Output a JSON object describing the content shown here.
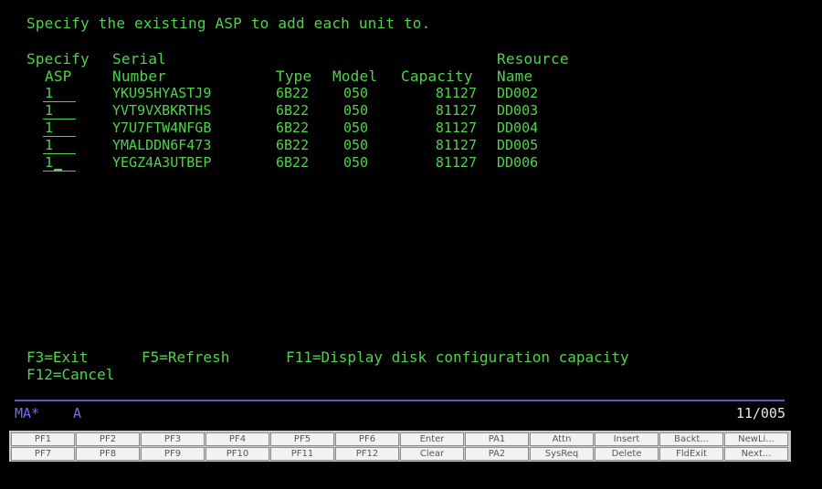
{
  "screen": {
    "instruction": "Specify the existing ASP to add each unit to.",
    "headers": {
      "specify_1": "Specify",
      "specify_2": "ASP",
      "serial_1": "Serial",
      "serial_2": "Number",
      "type": "Type",
      "model": "Model",
      "capacity": "Capacity",
      "resource_1": "Resource",
      "resource_2": "Name"
    },
    "rows": [
      {
        "asp": "1",
        "serial": "YKU95HYASTJ9",
        "type": "6B22",
        "model": "050",
        "capacity": "81127",
        "resource": "DD002"
      },
      {
        "asp": "1",
        "serial": "YVT9VXBKRTHS",
        "type": "6B22",
        "model": "050",
        "capacity": "81127",
        "resource": "DD003"
      },
      {
        "asp": "1",
        "serial": "Y7U7FTW4NFGB",
        "type": "6B22",
        "model": "050",
        "capacity": "81127",
        "resource": "DD004"
      },
      {
        "asp": "1",
        "serial": "YMALDDN6F473",
        "type": "6B22",
        "model": "050",
        "capacity": "81127",
        "resource": "DD005"
      },
      {
        "asp": "1",
        "serial": "YEGZ4A3UTBEP",
        "type": "6B22",
        "model": "050",
        "capacity": "81127",
        "resource": "DD006"
      }
    ],
    "function_keys": {
      "f3": "F3=Exit",
      "f5": "F5=Refresh",
      "f11": "F11=Display disk configuration capacity",
      "f12": "F12=Cancel"
    }
  },
  "status_bar": {
    "session": "MA*",
    "mode": "A",
    "cursor_position": "11/005"
  },
  "keypad": {
    "row1": [
      "PF1",
      "PF2",
      "PF3",
      "PF4",
      "PF5",
      "PF6",
      "Enter",
      "PA1",
      "Attn",
      "Insert",
      "Backt...",
      "NewLi..."
    ],
    "row2": [
      "PF7",
      "PF8",
      "PF9",
      "PF10",
      "PF11",
      "PF12",
      "Clear",
      "PA2",
      "SysReq",
      "Delete",
      "FldExit",
      "Next..."
    ]
  },
  "colors": {
    "screen_text": "#4fd34a",
    "background": "#000000",
    "divider": "#5e57c8"
  }
}
